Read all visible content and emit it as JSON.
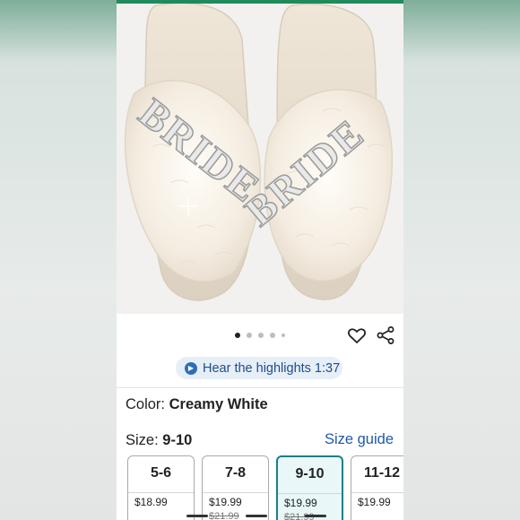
{
  "gallery": {
    "image_text": "BRIDE",
    "dot_count": 5,
    "active_dot": 0
  },
  "hear_highlights": {
    "label": "Hear the highlights 1:37",
    "icon": "speaker-icon"
  },
  "color": {
    "label": "Color:",
    "value": "Creamy White"
  },
  "size": {
    "label": "Size:",
    "value": "9-10",
    "guide_label": "Size guide"
  },
  "sizes": [
    {
      "label": "5-6",
      "price": "$18.99",
      "old_price": "",
      "selected": false
    },
    {
      "label": "7-8",
      "price": "$19.99",
      "old_price": "$21.99",
      "selected": false
    },
    {
      "label": "9-10",
      "price": "$19.99",
      "old_price": "$21.99",
      "selected": true
    },
    {
      "label": "11-12",
      "price": "$19.99",
      "old_price": "",
      "selected": false
    }
  ],
  "colors": {
    "link": "#1e5aa8",
    "selected_border": "#1b7f86",
    "brand_green": "#1f8a5b"
  }
}
